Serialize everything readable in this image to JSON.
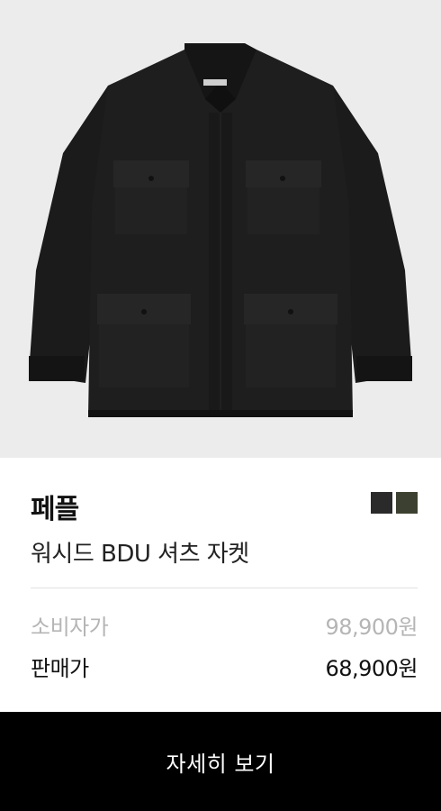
{
  "product": {
    "image_icon": "jacket-product-photo",
    "brand": "페플",
    "name": "워시드 BDU 셔츠 자켓",
    "color_swatches": [
      {
        "color": "#2a2a2a"
      },
      {
        "color": "#3b4030"
      }
    ]
  },
  "pricing": {
    "retail_label": "소비자가",
    "retail_value": "98,900원",
    "sale_label": "판매가",
    "sale_value": "68,900원"
  },
  "actions": {
    "detail_label": "자세히 보기"
  }
}
